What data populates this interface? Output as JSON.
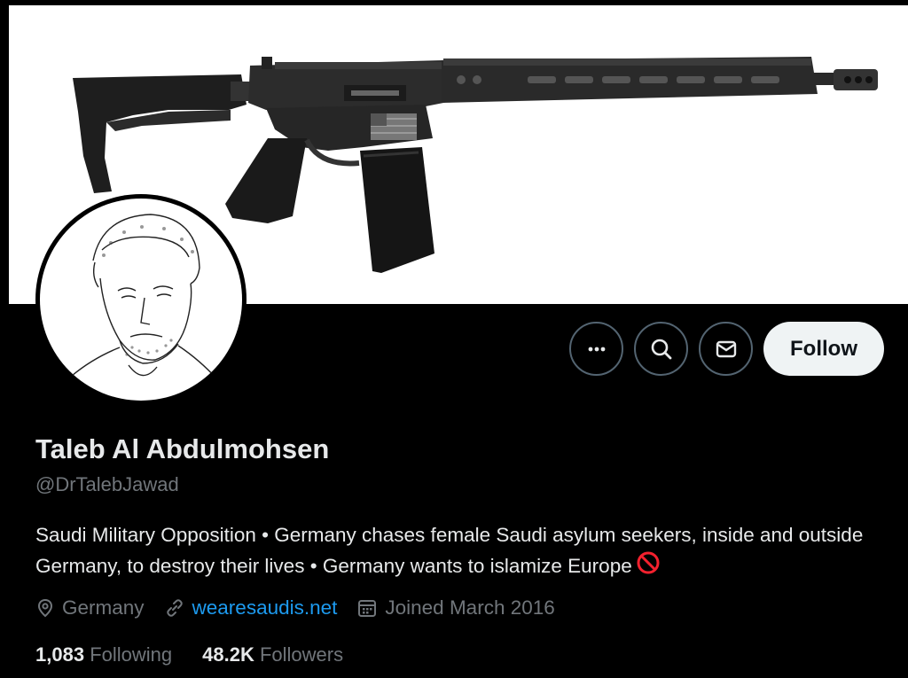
{
  "profile": {
    "name": "Taleb Al Abdulmohsen",
    "handle": "@DrTalebJawad",
    "bio": "Saudi Military Opposition • Germany chases female Saudi asylum seekers, inside and outside Germany, to destroy their lives • Germany wants to islamize Europe",
    "location": "Germany",
    "website": "wearesaudis.net",
    "joined": "Joined March 2016",
    "following_count": "1,083",
    "following_label": "Following",
    "followers_count": "48.2K",
    "followers_label": "Followers"
  },
  "actions": {
    "more_icon": "more-icon",
    "search_icon": "search-icon",
    "message_icon": "mail-icon",
    "follow_label": "Follow"
  },
  "colors": {
    "background": "#000000",
    "text_primary": "#e7e9ea",
    "text_secondary": "#71767b",
    "link": "#1d9bf0",
    "follow_button_bg": "#eff3f4",
    "no_sign": "#f4212e"
  }
}
